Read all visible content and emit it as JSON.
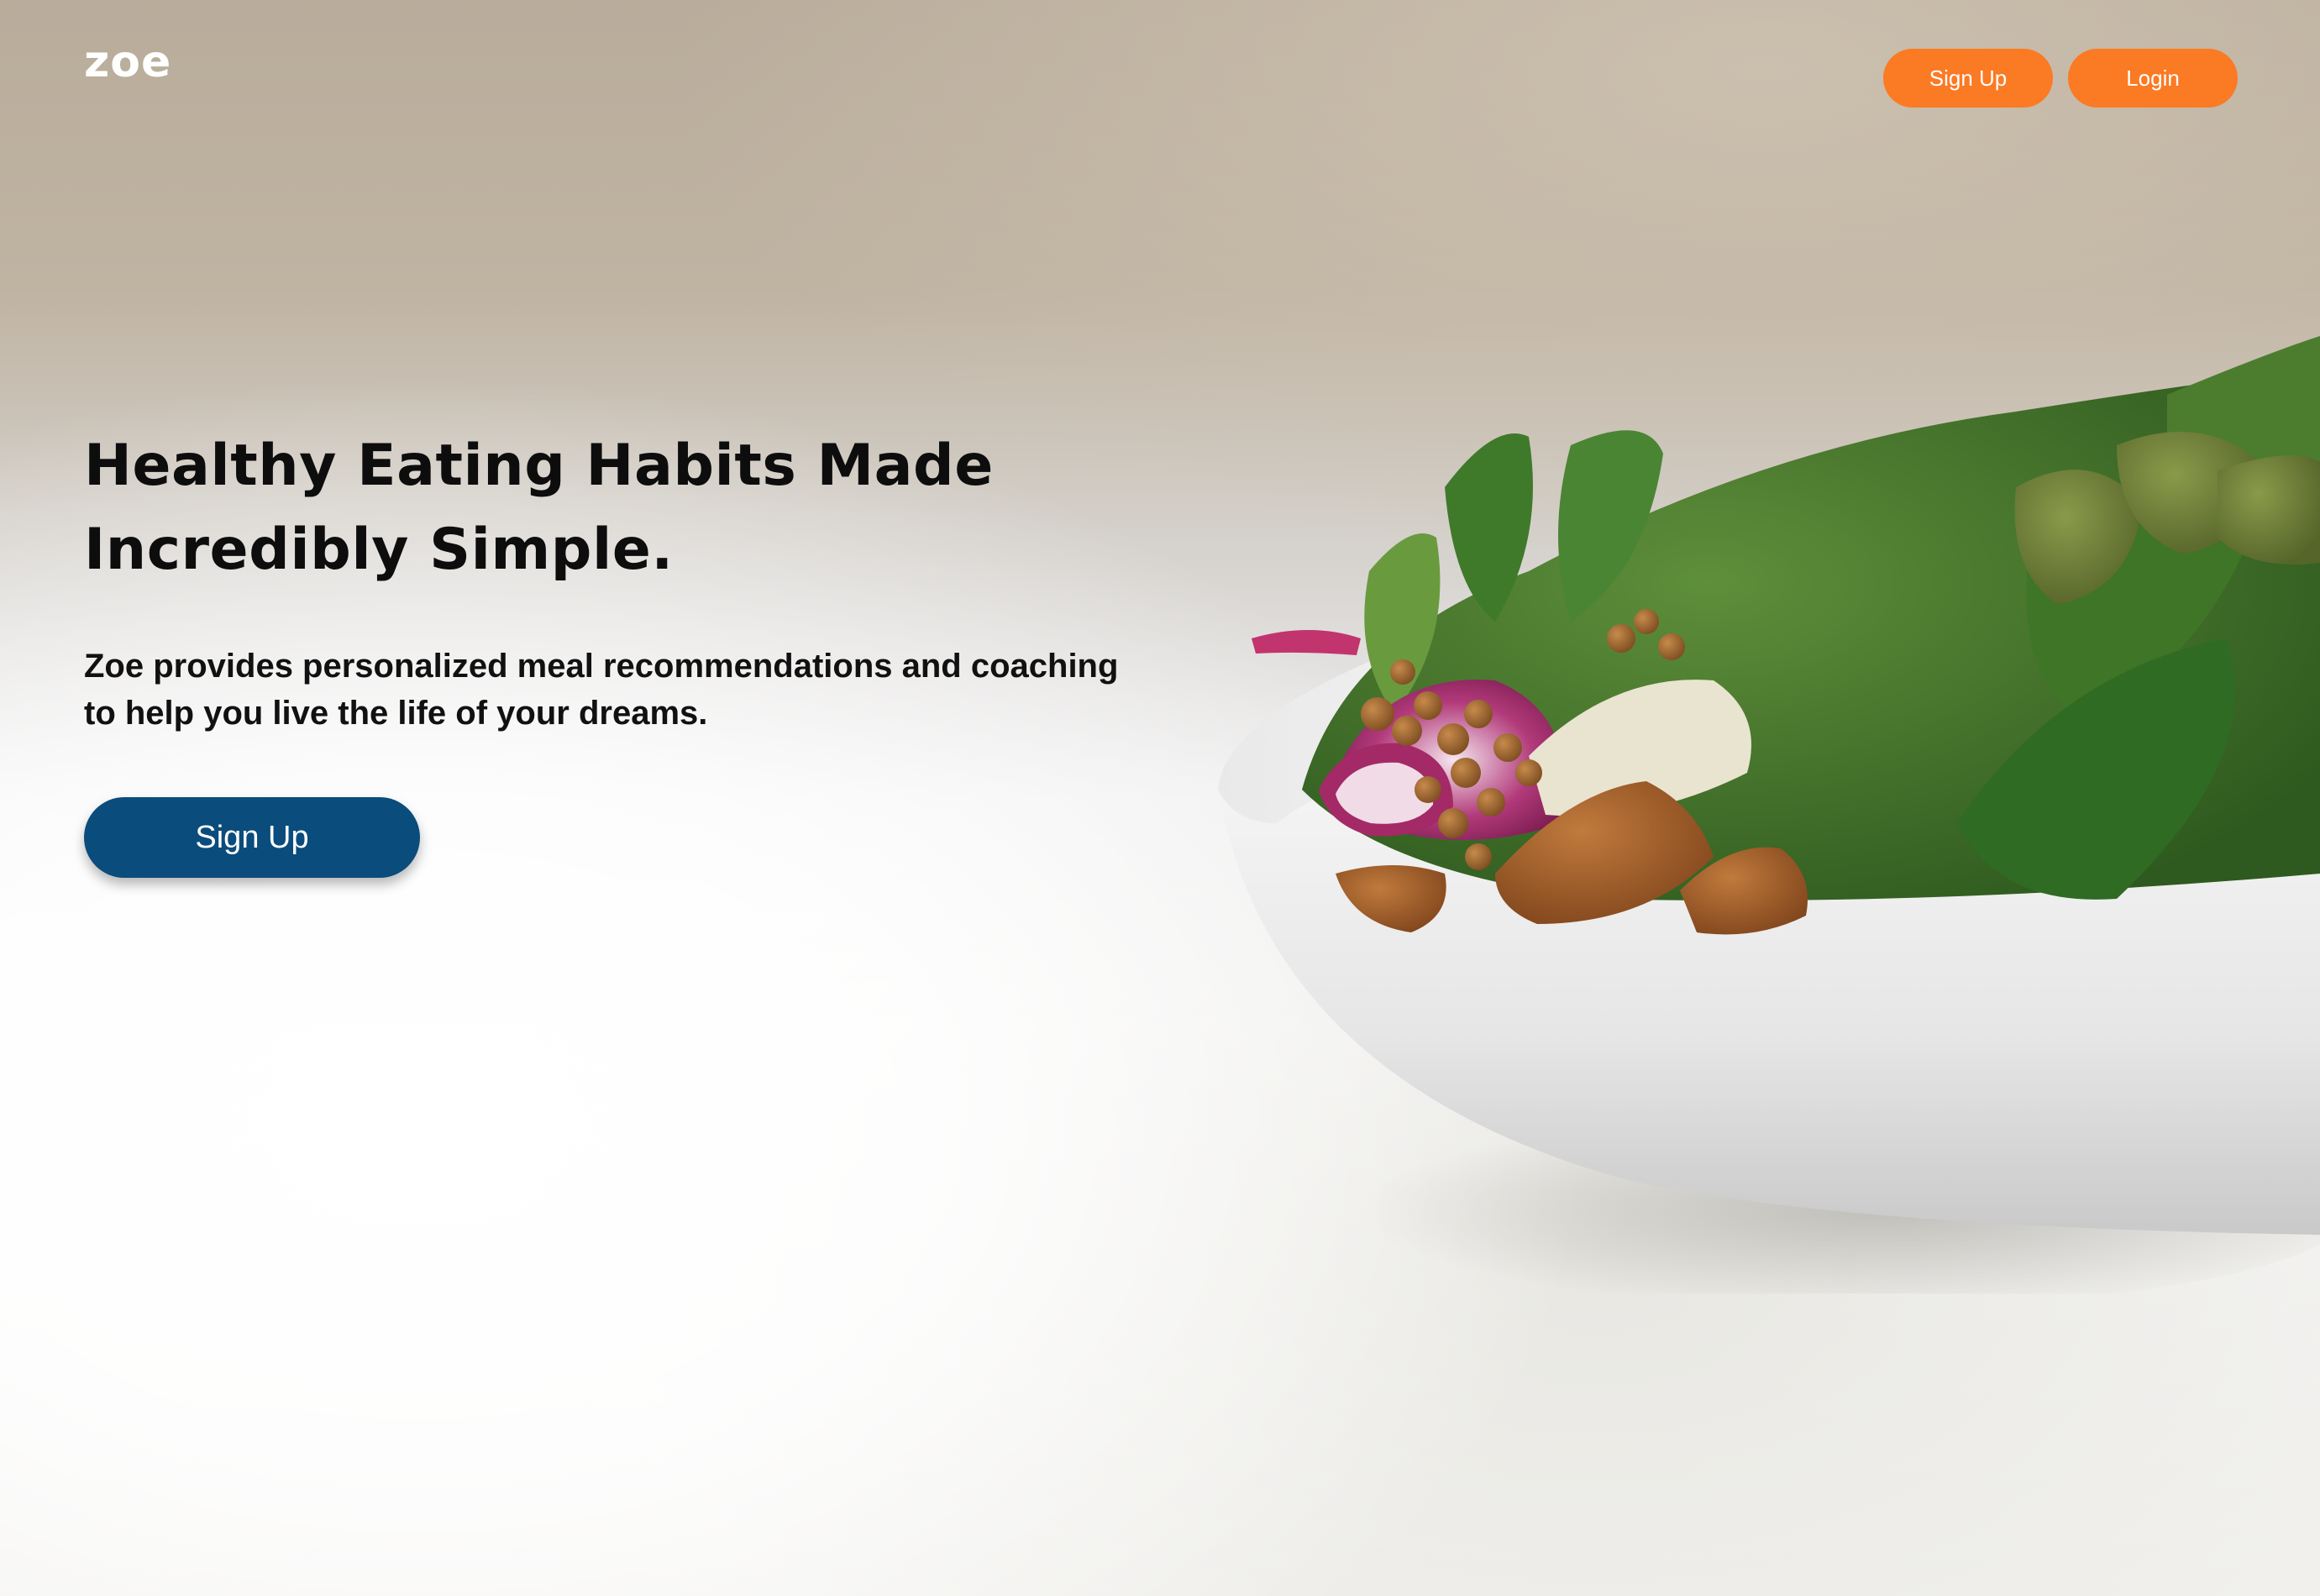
{
  "header": {
    "logo_text": "zoe",
    "signup_label": "Sign Up",
    "login_label": "Login"
  },
  "hero": {
    "title": "Healthy Eating Habits Made Incredibly Simple.",
    "subtitle": "Zoe provides personalized meal recommendations and coaching to help you live the life of your dreams.",
    "cta_label": "Sign Up"
  },
  "colors": {
    "nav_button": "#fb7a24",
    "cta_button": "#0a4c7c",
    "heading_text": "#0d0d0d",
    "logo_text": "#ffffff"
  }
}
